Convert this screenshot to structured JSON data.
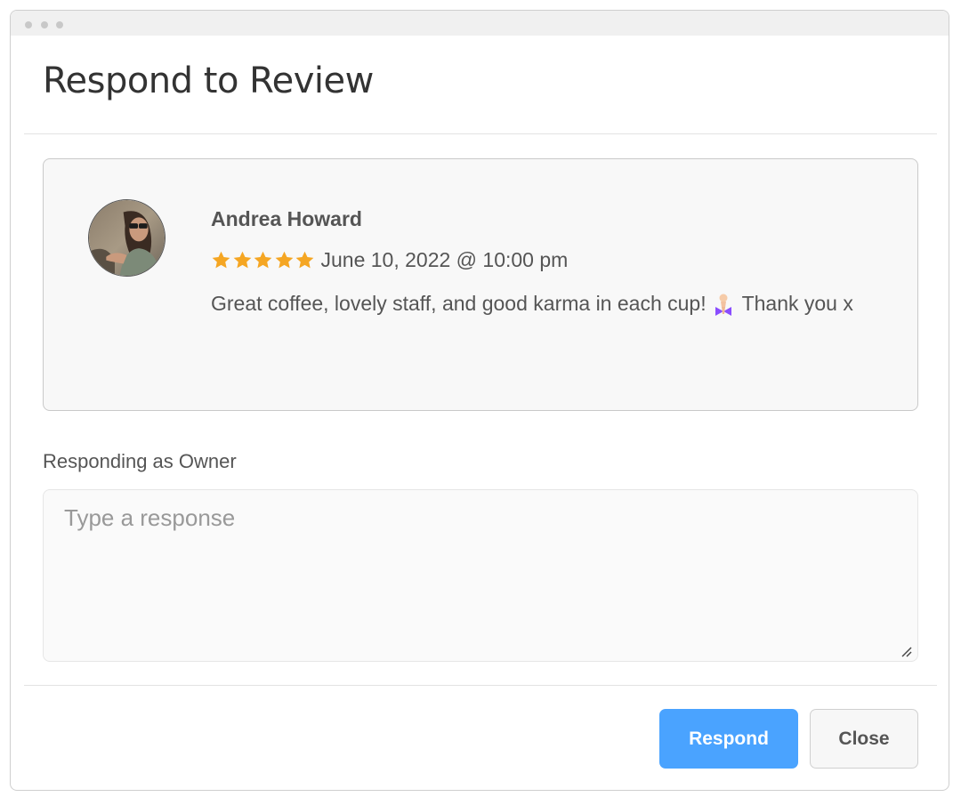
{
  "modal": {
    "title": "Respond to Review"
  },
  "review": {
    "author": "Andrea Howard",
    "rating": 5,
    "rating_max": 5,
    "date": "June 10, 2022 @ 10:00 pm",
    "text_before_emoji": "Great coffee, lovely staff, and good karma in each cup!",
    "emoji": "person-with-folded-hands-emoji",
    "text_after_emoji": "Thank you x",
    "star_color": "#f5a623"
  },
  "response": {
    "label": "Responding as Owner",
    "placeholder": "Type a response",
    "value": ""
  },
  "actions": {
    "respond_label": "Respond",
    "close_label": "Close",
    "respond_color": "#4aa3ff"
  },
  "icons": {
    "avatar": "user-avatar-photo",
    "star": "star-icon",
    "resize": "resize-handle-icon"
  }
}
